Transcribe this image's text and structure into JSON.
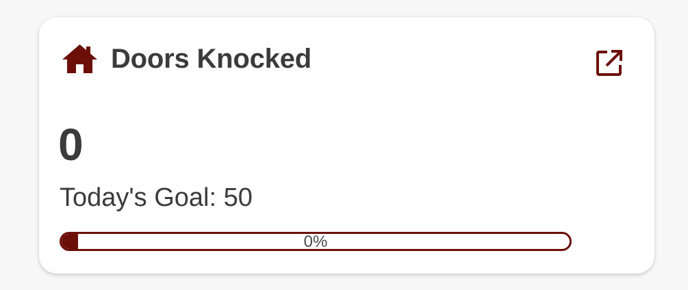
{
  "card": {
    "title": "Doors Knocked",
    "title_icon": "home-icon",
    "action_icon": "open-in-new-icon",
    "count": "0",
    "goal_text": "Today's Goal: 50",
    "progress": {
      "value_fraction": 0,
      "label": "0%"
    }
  },
  "colors": {
    "accent": "#6b0f08",
    "text": "#3b3b3b",
    "background": "#f7f7f7",
    "card": "#ffffff"
  }
}
